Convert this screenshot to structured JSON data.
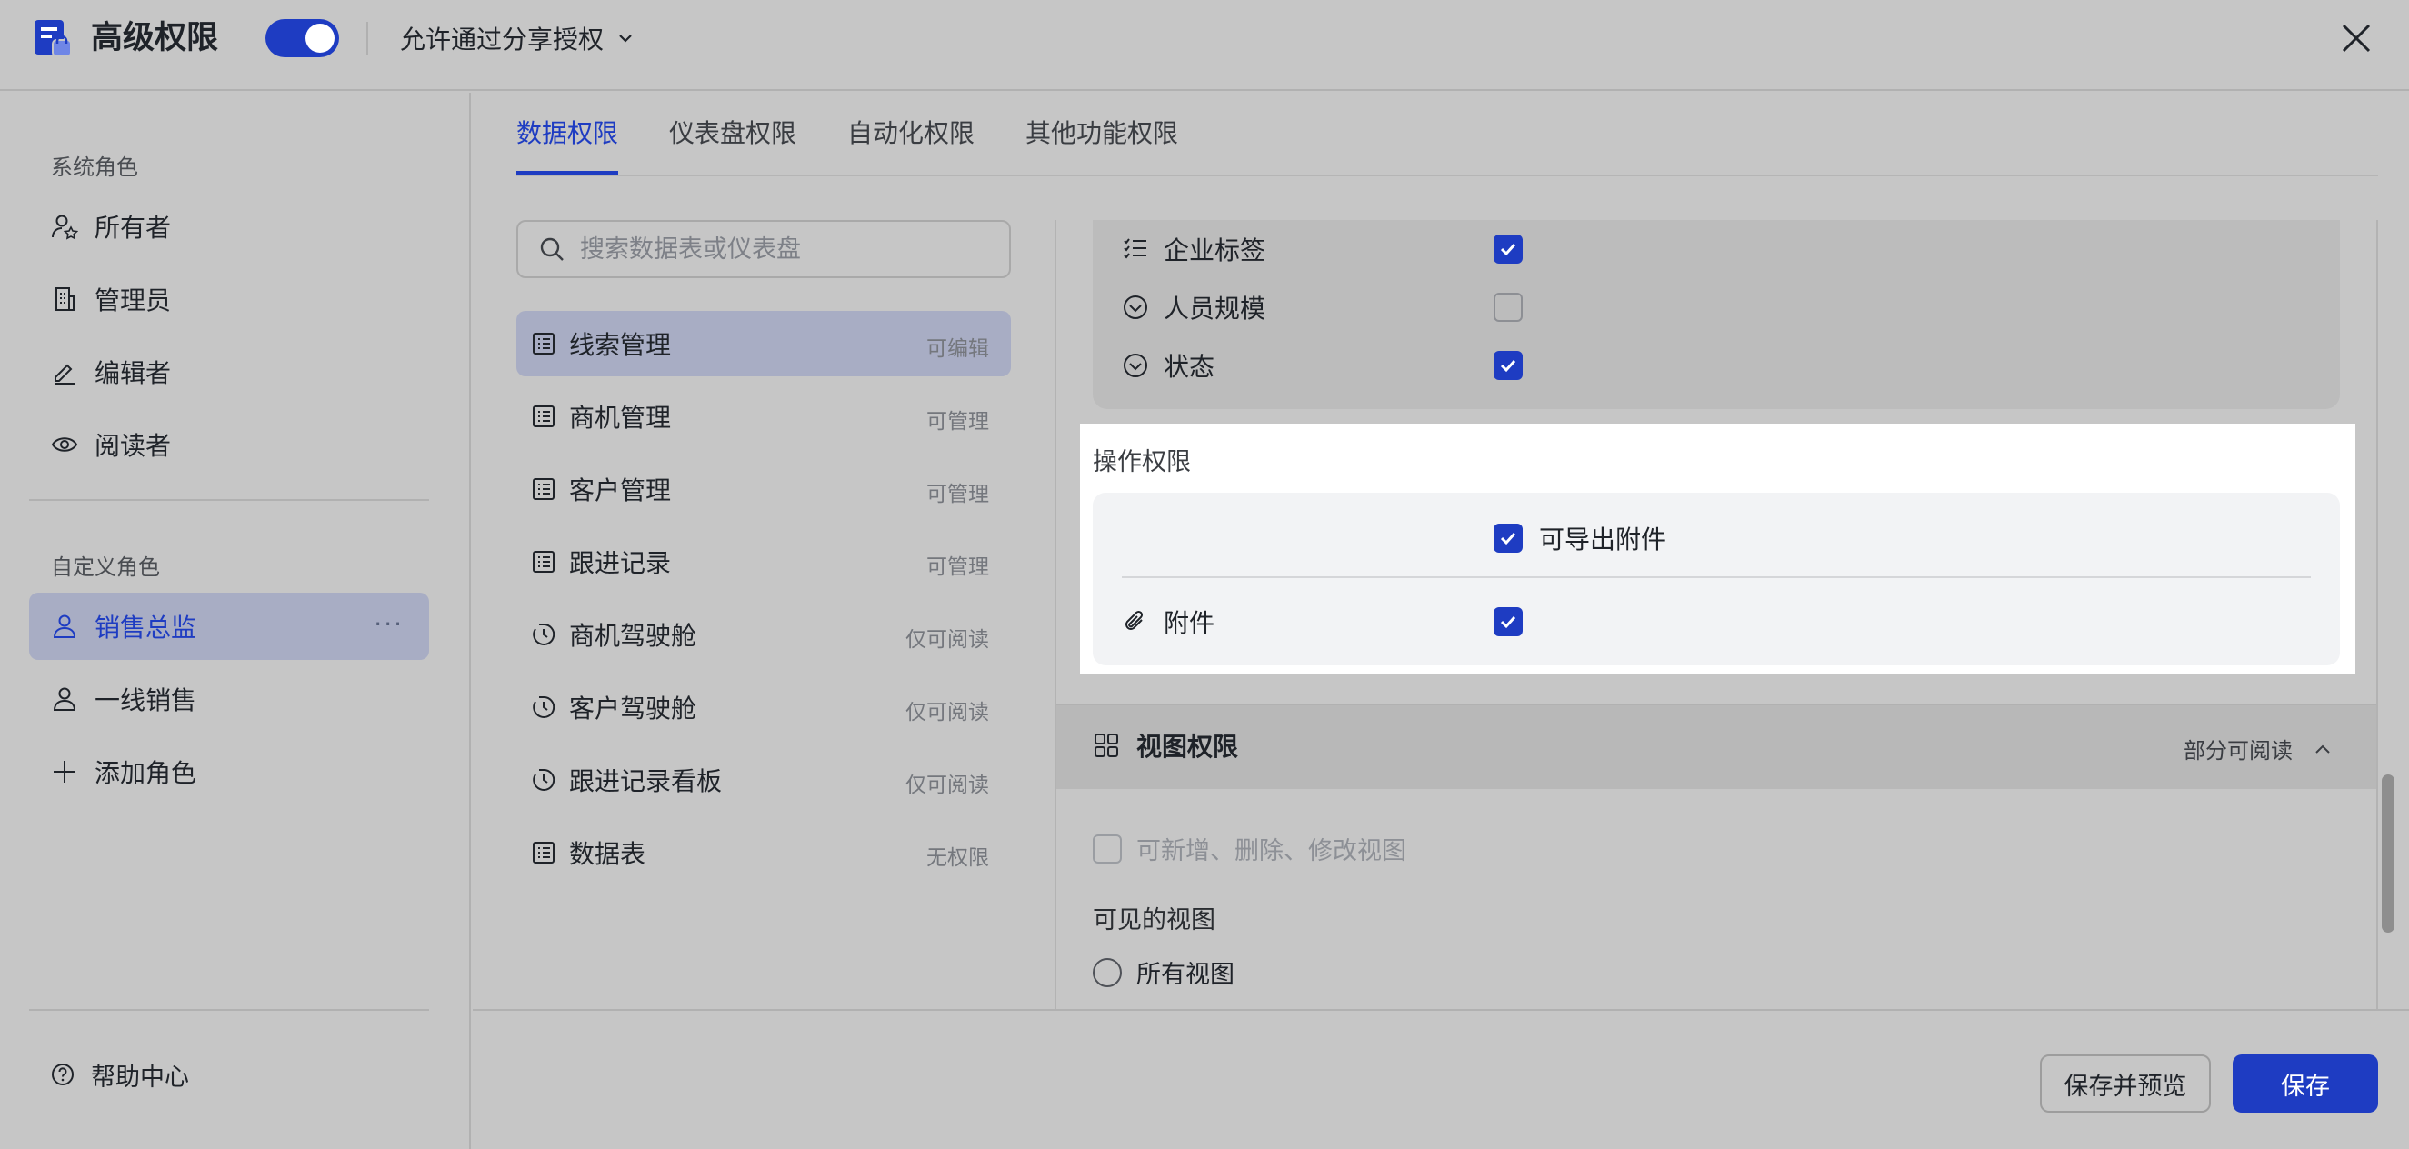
{
  "header": {
    "title": "高级权限",
    "toggle_on": true,
    "share_option": "允许通过分享授权"
  },
  "sidebar": {
    "system_roles_label": "系统角色",
    "system_roles": [
      {
        "label": "所有者",
        "icon": "owner-icon"
      },
      {
        "label": "管理员",
        "icon": "admin-building-icon"
      },
      {
        "label": "编辑者",
        "icon": "edit-pen-icon"
      },
      {
        "label": "阅读者",
        "icon": "eye-icon"
      }
    ],
    "custom_roles_label": "自定义角色",
    "custom_roles": [
      {
        "label": "销售总监",
        "icon": "user-icon",
        "active": true,
        "more": "···"
      },
      {
        "label": "一线销售",
        "icon": "user-icon"
      }
    ],
    "add_role": "添加角色",
    "help": "帮助中心"
  },
  "tabs": [
    {
      "label": "数据权限",
      "active": true
    },
    {
      "label": "仪表盘权限"
    },
    {
      "label": "自动化权限"
    },
    {
      "label": "其他功能权限"
    }
  ],
  "search": {
    "placeholder": "搜索数据表或仪表盘"
  },
  "tables": [
    {
      "label": "线索管理",
      "perm": "可编辑",
      "icon": "table-icon",
      "active": true
    },
    {
      "label": "商机管理",
      "perm": "可管理",
      "icon": "table-icon"
    },
    {
      "label": "客户管理",
      "perm": "可管理",
      "icon": "table-icon"
    },
    {
      "label": "跟进记录",
      "perm": "可管理",
      "icon": "table-icon"
    },
    {
      "label": "商机驾驶舱",
      "perm": "仅可阅读",
      "icon": "dashboard-icon"
    },
    {
      "label": "客户驾驶舱",
      "perm": "仅可阅读",
      "icon": "dashboard-icon"
    },
    {
      "label": "跟进记录看板",
      "perm": "仅可阅读",
      "icon": "dashboard-icon"
    },
    {
      "label": "数据表",
      "perm": "无权限",
      "icon": "table-icon"
    }
  ],
  "fields": [
    {
      "label": "企业标签",
      "icon": "multi-select-icon",
      "checked": true
    },
    {
      "label": "人员规模",
      "icon": "single-select-icon",
      "checked": false
    },
    {
      "label": "状态",
      "icon": "single-select-icon",
      "checked": true
    }
  ],
  "operations": {
    "title": "操作权限",
    "export_label": "可导出附件",
    "export_checked": true,
    "attachment_label": "附件",
    "attachment_checked": true
  },
  "view_permissions": {
    "title": "视图权限",
    "status": "部分可阅读",
    "edit_views_label": "可新增、删除、修改视图",
    "visible_views_label": "可见的视图",
    "all_views_label": "所有视图"
  },
  "footer": {
    "save_preview": "保存并预览",
    "save": "保存"
  },
  "colors": {
    "accent": "#1e3cc2",
    "overlay_gray": "#c6c6c6",
    "highlight": "#ffffff"
  }
}
